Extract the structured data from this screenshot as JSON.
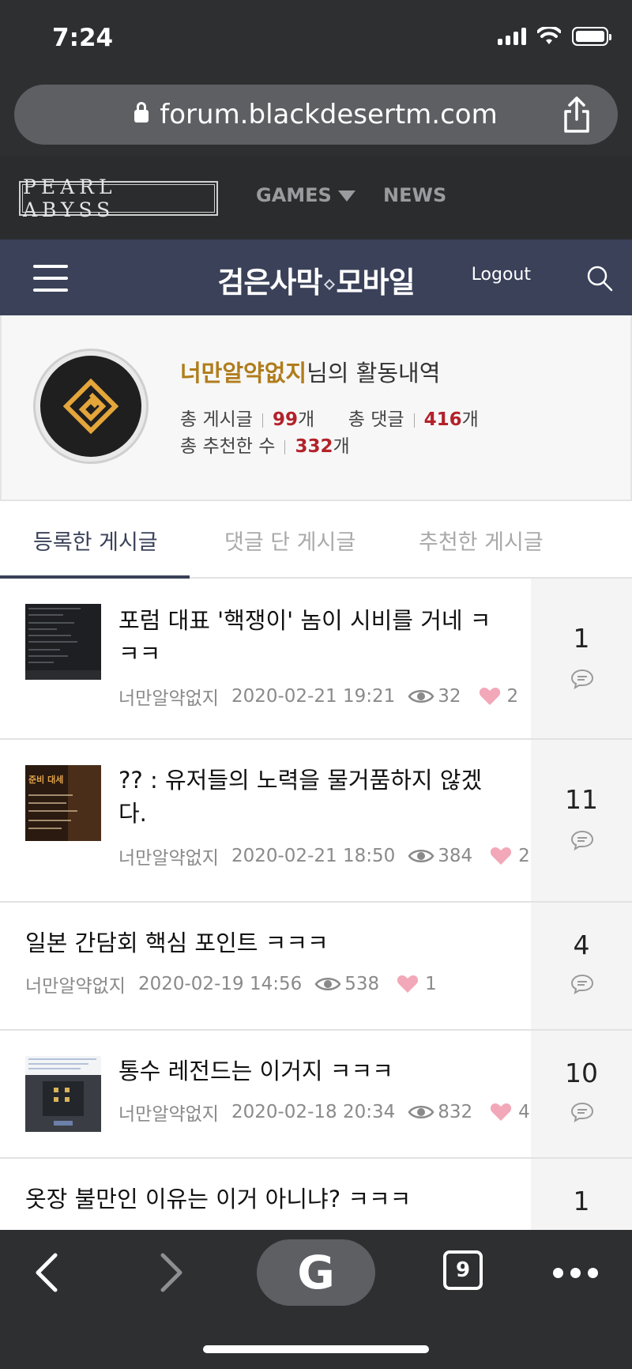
{
  "status_bar": {
    "time": "7:24"
  },
  "browser": {
    "url": "forum.blackdesertm.com",
    "tab_count": "9",
    "search_engine_glyph": "G"
  },
  "site_nav": {
    "logo": "PEARL ABYSS",
    "games": "GAMES",
    "news": "NEWS"
  },
  "forum_header": {
    "title_left": "검은사막",
    "title_right": "모바일",
    "logout": "Logout"
  },
  "profile": {
    "nickname": "너만알약없지",
    "title_suffix": "님의 활동내역",
    "posts_label": "총 게시글",
    "posts_count": "99",
    "comments_label": "총 댓글",
    "comments_count": "416",
    "likes_label": "총 추천한 수",
    "likes_count": "332",
    "unit": "개"
  },
  "tabs": [
    {
      "label": "등록한 게시글",
      "active": true
    },
    {
      "label": "댓글 단 게시글",
      "active": false
    },
    {
      "label": "추천한 게시글",
      "active": false
    }
  ],
  "posts": [
    {
      "title_line1": "포럼 대표 '핵쟁이' 놈이 시비를 거네 ㅋ",
      "title_line2": "ㅋㅋ",
      "author": "너만알약없지",
      "date": "2020-02-21 19:21",
      "views": "32",
      "likes": "2",
      "comments": "1",
      "has_thumb": true
    },
    {
      "title_line1": "?? : 유저들의 노력을 물거품하지 않겠",
      "title_line2": "다.",
      "author": "너만알약없지",
      "date": "2020-02-21 18:50",
      "views": "384",
      "likes": "2",
      "comments": "11",
      "has_thumb": true
    },
    {
      "title_line1": "일본 간담회 핵심 포인트 ㅋㅋㅋ",
      "title_line2": "",
      "author": "너만알약없지",
      "date": "2020-02-19 14:56",
      "views": "538",
      "likes": "1",
      "comments": "4",
      "has_thumb": false
    },
    {
      "title_line1": "통수 레전드는 이거지 ㅋㅋㅋ",
      "title_line2": "",
      "author": "너만알약없지",
      "date": "2020-02-18 20:34",
      "views": "832",
      "likes": "4",
      "comments": "10",
      "has_thumb": true
    },
    {
      "title_line1": "옷장 불만인 이유는 이거 아니냐? ㅋㅋㅋ",
      "title_line2": "",
      "comments": "1",
      "has_thumb": false
    }
  ],
  "thumbs": {
    "t2_caption": "준비 대세"
  },
  "colors": {
    "forum_header_bg": "#3a4159",
    "nickname": "#b07d1c",
    "count_red": "#b3222a",
    "heart": "#f2a8b8"
  }
}
